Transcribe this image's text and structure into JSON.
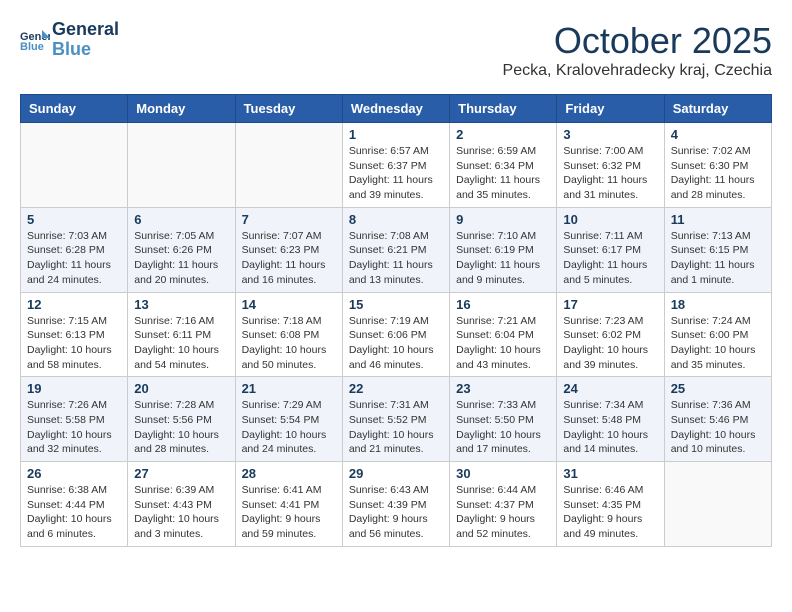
{
  "logo": {
    "line1": "General",
    "line2": "Blue"
  },
  "title": "October 2025",
  "location": "Pecka, Kralovehradecky kraj, Czechia",
  "headers": [
    "Sunday",
    "Monday",
    "Tuesday",
    "Wednesday",
    "Thursday",
    "Friday",
    "Saturday"
  ],
  "weeks": [
    [
      {
        "day": "",
        "info": ""
      },
      {
        "day": "",
        "info": ""
      },
      {
        "day": "",
        "info": ""
      },
      {
        "day": "1",
        "info": "Sunrise: 6:57 AM\nSunset: 6:37 PM\nDaylight: 11 hours\nand 39 minutes."
      },
      {
        "day": "2",
        "info": "Sunrise: 6:59 AM\nSunset: 6:34 PM\nDaylight: 11 hours\nand 35 minutes."
      },
      {
        "day": "3",
        "info": "Sunrise: 7:00 AM\nSunset: 6:32 PM\nDaylight: 11 hours\nand 31 minutes."
      },
      {
        "day": "4",
        "info": "Sunrise: 7:02 AM\nSunset: 6:30 PM\nDaylight: 11 hours\nand 28 minutes."
      }
    ],
    [
      {
        "day": "5",
        "info": "Sunrise: 7:03 AM\nSunset: 6:28 PM\nDaylight: 11 hours\nand 24 minutes."
      },
      {
        "day": "6",
        "info": "Sunrise: 7:05 AM\nSunset: 6:26 PM\nDaylight: 11 hours\nand 20 minutes."
      },
      {
        "day": "7",
        "info": "Sunrise: 7:07 AM\nSunset: 6:23 PM\nDaylight: 11 hours\nand 16 minutes."
      },
      {
        "day": "8",
        "info": "Sunrise: 7:08 AM\nSunset: 6:21 PM\nDaylight: 11 hours\nand 13 minutes."
      },
      {
        "day": "9",
        "info": "Sunrise: 7:10 AM\nSunset: 6:19 PM\nDaylight: 11 hours\nand 9 minutes."
      },
      {
        "day": "10",
        "info": "Sunrise: 7:11 AM\nSunset: 6:17 PM\nDaylight: 11 hours\nand 5 minutes."
      },
      {
        "day": "11",
        "info": "Sunrise: 7:13 AM\nSunset: 6:15 PM\nDaylight: 11 hours\nand 1 minute."
      }
    ],
    [
      {
        "day": "12",
        "info": "Sunrise: 7:15 AM\nSunset: 6:13 PM\nDaylight: 10 hours\nand 58 minutes."
      },
      {
        "day": "13",
        "info": "Sunrise: 7:16 AM\nSunset: 6:11 PM\nDaylight: 10 hours\nand 54 minutes."
      },
      {
        "day": "14",
        "info": "Sunrise: 7:18 AM\nSunset: 6:08 PM\nDaylight: 10 hours\nand 50 minutes."
      },
      {
        "day": "15",
        "info": "Sunrise: 7:19 AM\nSunset: 6:06 PM\nDaylight: 10 hours\nand 46 minutes."
      },
      {
        "day": "16",
        "info": "Sunrise: 7:21 AM\nSunset: 6:04 PM\nDaylight: 10 hours\nand 43 minutes."
      },
      {
        "day": "17",
        "info": "Sunrise: 7:23 AM\nSunset: 6:02 PM\nDaylight: 10 hours\nand 39 minutes."
      },
      {
        "day": "18",
        "info": "Sunrise: 7:24 AM\nSunset: 6:00 PM\nDaylight: 10 hours\nand 35 minutes."
      }
    ],
    [
      {
        "day": "19",
        "info": "Sunrise: 7:26 AM\nSunset: 5:58 PM\nDaylight: 10 hours\nand 32 minutes."
      },
      {
        "day": "20",
        "info": "Sunrise: 7:28 AM\nSunset: 5:56 PM\nDaylight: 10 hours\nand 28 minutes."
      },
      {
        "day": "21",
        "info": "Sunrise: 7:29 AM\nSunset: 5:54 PM\nDaylight: 10 hours\nand 24 minutes."
      },
      {
        "day": "22",
        "info": "Sunrise: 7:31 AM\nSunset: 5:52 PM\nDaylight: 10 hours\nand 21 minutes."
      },
      {
        "day": "23",
        "info": "Sunrise: 7:33 AM\nSunset: 5:50 PM\nDaylight: 10 hours\nand 17 minutes."
      },
      {
        "day": "24",
        "info": "Sunrise: 7:34 AM\nSunset: 5:48 PM\nDaylight: 10 hours\nand 14 minutes."
      },
      {
        "day": "25",
        "info": "Sunrise: 7:36 AM\nSunset: 5:46 PM\nDaylight: 10 hours\nand 10 minutes."
      }
    ],
    [
      {
        "day": "26",
        "info": "Sunrise: 6:38 AM\nSunset: 4:44 PM\nDaylight: 10 hours\nand 6 minutes."
      },
      {
        "day": "27",
        "info": "Sunrise: 6:39 AM\nSunset: 4:43 PM\nDaylight: 10 hours\nand 3 minutes."
      },
      {
        "day": "28",
        "info": "Sunrise: 6:41 AM\nSunset: 4:41 PM\nDaylight: 9 hours\nand 59 minutes."
      },
      {
        "day": "29",
        "info": "Sunrise: 6:43 AM\nSunset: 4:39 PM\nDaylight: 9 hours\nand 56 minutes."
      },
      {
        "day": "30",
        "info": "Sunrise: 6:44 AM\nSunset: 4:37 PM\nDaylight: 9 hours\nand 52 minutes."
      },
      {
        "day": "31",
        "info": "Sunrise: 6:46 AM\nSunset: 4:35 PM\nDaylight: 9 hours\nand 49 minutes."
      },
      {
        "day": "",
        "info": ""
      }
    ]
  ]
}
